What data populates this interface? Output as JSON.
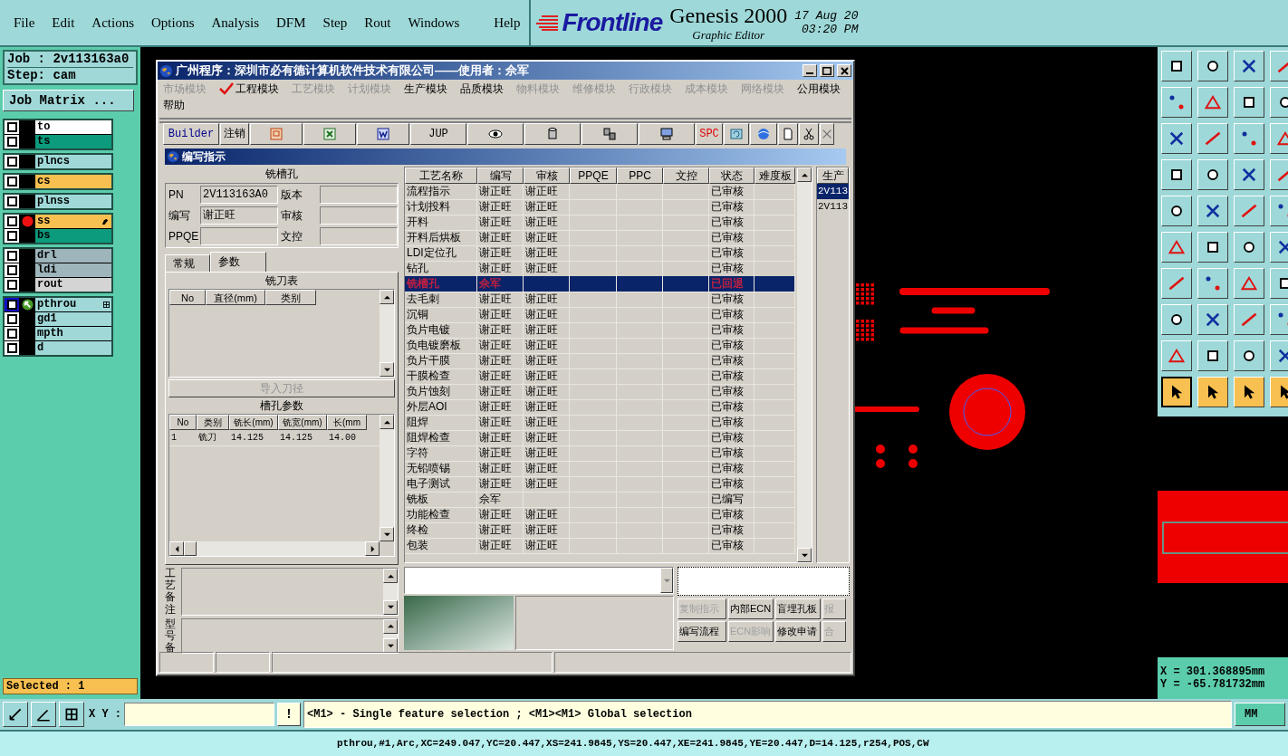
{
  "menu_bar": {
    "items": [
      "File",
      "Edit",
      "Actions",
      "Options",
      "Analysis",
      "DFM",
      "Step",
      "Rout",
      "Windows"
    ],
    "help": "Help"
  },
  "brand": {
    "logo": "Frontline",
    "product": "Genesis 2000",
    "subtitle": "Graphic Editor",
    "date": "17 Aug 20",
    "time": "03:20 PM"
  },
  "job_panel": {
    "job": "Job : 2v113163a0",
    "step": "Step: cam",
    "matrix_button": "Job Matrix ...",
    "selected_count": "Selected : 1",
    "layer_groups": [
      {
        "layers": [
          {
            "name": "to",
            "color": "#ffffff",
            "checked": false,
            "work": false,
            "displayed": false,
            "pointer": false,
            "expandable": false
          },
          {
            "name": "ts",
            "color": "#0c9b7c",
            "checked": false,
            "work": false,
            "displayed": false,
            "pointer": false,
            "expandable": false
          }
        ]
      },
      {
        "layers": [
          {
            "name": "plncs",
            "color": "#a0d8d8",
            "checked": false,
            "work": false,
            "displayed": false,
            "pointer": false,
            "expandable": false
          }
        ]
      },
      {
        "layers": [
          {
            "name": "cs",
            "color": "#f8c050",
            "checked": false,
            "work": false,
            "displayed": false,
            "pointer": false,
            "expandable": false
          }
        ]
      },
      {
        "layers": [
          {
            "name": "plnss",
            "color": "#a0d8d8",
            "checked": false,
            "work": false,
            "displayed": false,
            "pointer": false,
            "expandable": false
          }
        ]
      },
      {
        "layers": [
          {
            "name": "ss",
            "color": "#f8c050",
            "checked": false,
            "work": false,
            "displayed": true,
            "pointer": true,
            "expandable": false
          },
          {
            "name": "bs",
            "color": "#0c9b7c",
            "checked": false,
            "work": false,
            "displayed": false,
            "pointer": false,
            "expandable": false
          }
        ]
      },
      {
        "layers": [
          {
            "name": "drl",
            "color": "#9fb5bc",
            "checked": false,
            "work": false,
            "displayed": false,
            "pointer": false,
            "expandable": false
          },
          {
            "name": "ldi",
            "color": "#9fb5bc",
            "checked": false,
            "work": false,
            "displayed": false,
            "pointer": false,
            "expandable": false
          },
          {
            "name": "rout",
            "color": "#d4d4d4",
            "checked": false,
            "work": false,
            "displayed": false,
            "pointer": false,
            "expandable": false
          }
        ]
      },
      {
        "layers": [
          {
            "name": "pthrou",
            "color": "#a0d8d8",
            "checked": false,
            "work": true,
            "displayed": false,
            "pointer": false,
            "expandable": true
          },
          {
            "name": "gd1",
            "color": "#a0d8d8",
            "checked": false,
            "work": false,
            "displayed": false,
            "pointer": false,
            "expandable": false
          },
          {
            "name": "mpth",
            "color": "#a0d8d8",
            "checked": false,
            "work": false,
            "displayed": false,
            "pointer": false,
            "expandable": false
          },
          {
            "name": "d",
            "color": "#a0d8d8",
            "checked": false,
            "work": false,
            "displayed": false,
            "pointer": false,
            "expandable": false
          }
        ]
      }
    ]
  },
  "dialog": {
    "title": "广州程序：深圳市必有德计算机软件技术有限公司——使用者：佘军",
    "modules": [
      {
        "label": "市场模块",
        "disabled": true,
        "checked": false
      },
      {
        "label": "工程模块",
        "disabled": false,
        "checked": true
      },
      {
        "label": "工艺模块",
        "disabled": true,
        "checked": false
      },
      {
        "label": "计划模块",
        "disabled": true,
        "checked": false
      },
      {
        "label": "生产模块",
        "disabled": false,
        "checked": false
      },
      {
        "label": "品质模块",
        "disabled": false,
        "checked": false
      },
      {
        "label": "物料模块",
        "disabled": true,
        "checked": false
      },
      {
        "label": "维修模块",
        "disabled": true,
        "checked": false
      },
      {
        "label": "行政模块",
        "disabled": true,
        "checked": false
      },
      {
        "label": "成本模块",
        "disabled": true,
        "checked": false
      },
      {
        "label": "网络模块",
        "disabled": true,
        "checked": false
      },
      {
        "label": "公用模块",
        "disabled": false,
        "checked": false
      },
      {
        "label": "帮助",
        "disabled": false,
        "checked": false
      }
    ],
    "toolbar": [
      {
        "kind": "text",
        "label": "Builder",
        "color": "#00008b"
      },
      {
        "kind": "text",
        "label": "注销",
        "color": "#000000"
      },
      {
        "kind": "icon"
      },
      {
        "kind": "icon"
      },
      {
        "kind": "icon"
      },
      {
        "kind": "text",
        "label": "JUP",
        "color": "#000000"
      },
      {
        "kind": "icon"
      },
      {
        "kind": "icon"
      },
      {
        "kind": "icon"
      },
      {
        "kind": "icon"
      },
      {
        "kind": "text",
        "label": "SPC",
        "color": "#e00000"
      },
      {
        "kind": "icon"
      },
      {
        "kind": "icon"
      },
      {
        "kind": "icon"
      },
      {
        "kind": "icon"
      },
      {
        "kind": "icon"
      }
    ],
    "subwindow": {
      "title": "编写指示",
      "process_title": "铣槽孔",
      "fields": [
        {
          "label": "PN",
          "value": "2V113163A0"
        },
        {
          "label": "版本"
        },
        {
          "label": "编写",
          "value": "谢正旺"
        },
        {
          "label": "审核"
        },
        {
          "label": "PPQE"
        },
        {
          "label": "文控"
        }
      ],
      "tabs": [
        {
          "label": "常规",
          "selected": false
        },
        {
          "label": "参数",
          "selected": true
        }
      ],
      "cutter_table": {
        "title": "铣刀表",
        "columns": [
          "No",
          "直径(mm)",
          "类别"
        ]
      },
      "import_button": {
        "label": "导入刀径",
        "disabled": true
      },
      "slot_table": {
        "title": "槽孔参数",
        "columns": [
          "No",
          "类别",
          "铣长(mm)",
          "铣宽(mm)",
          "长(mm"
        ],
        "rows": [
          [
            "1",
            "铣刀",
            "14.125",
            "14.125",
            "14.00"
          ]
        ]
      },
      "notes": [
        "工艺备注",
        "型号备"
      ],
      "process_table": {
        "columns": [
          "工艺名称",
          "编写",
          "审核",
          "PPQE",
          "PPC",
          "文控",
          "状态",
          "难度板"
        ],
        "rows": [
          {
            "name": "流程指示",
            "writer": "谢正旺",
            "reviewer": "谢正旺",
            "status": "已审核",
            "selected": false
          },
          {
            "name": "计划投料",
            "writer": "谢正旺",
            "reviewer": "谢正旺",
            "status": "已审核",
            "selected": false
          },
          {
            "name": "开料",
            "writer": "谢正旺",
            "reviewer": "谢正旺",
            "status": "已审核",
            "selected": false
          },
          {
            "name": "开料后烘板",
            "writer": "谢正旺",
            "reviewer": "谢正旺",
            "status": "已审核",
            "selected": false
          },
          {
            "name": "LDI定位孔",
            "writer": "谢正旺",
            "reviewer": "谢正旺",
            "status": "已审核",
            "selected": false
          },
          {
            "name": "钻孔",
            "writer": "谢正旺",
            "reviewer": "谢正旺",
            "status": "已审核",
            "selected": false
          },
          {
            "name": "铣槽孔",
            "writer": "佘军",
            "status": "已回退",
            "selected": true
          },
          {
            "name": "去毛刺",
            "writer": "谢正旺",
            "reviewer": "谢正旺",
            "status": "已审核",
            "selected": false
          },
          {
            "name": "沉铜",
            "writer": "谢正旺",
            "reviewer": "谢正旺",
            "status": "已审核",
            "selected": false
          },
          {
            "name": "负片电镀",
            "writer": "谢正旺",
            "reviewer": "谢正旺",
            "status": "已审核",
            "selected": false
          },
          {
            "name": "负电镀磨板",
            "writer": "谢正旺",
            "reviewer": "谢正旺",
            "status": "已审核",
            "selected": false
          },
          {
            "name": "负片干膜",
            "writer": "谢正旺",
            "reviewer": "谢正旺",
            "status": "已审核",
            "selected": false
          },
          {
            "name": "干膜检查",
            "writer": "谢正旺",
            "reviewer": "谢正旺",
            "status": "已审核",
            "selected": false
          },
          {
            "name": "负片蚀刻",
            "writer": "谢正旺",
            "reviewer": "谢正旺",
            "status": "已审核",
            "selected": false
          },
          {
            "name": "外层AOI",
            "writer": "谢正旺",
            "reviewer": "谢正旺",
            "status": "已审核",
            "selected": false
          },
          {
            "name": "阻焊",
            "writer": "谢正旺",
            "reviewer": "谢正旺",
            "status": "已审核",
            "selected": false
          },
          {
            "name": "阻焊检查",
            "writer": "谢正旺",
            "reviewer": "谢正旺",
            "status": "已审核",
            "selected": false
          },
          {
            "name": "字符",
            "writer": "谢正旺",
            "reviewer": "谢正旺",
            "status": "已审核",
            "selected": false
          },
          {
            "name": "无铅喷锡",
            "writer": "谢正旺",
            "reviewer": "谢正旺",
            "status": "已审核",
            "selected": false
          },
          {
            "name": "电子测试",
            "writer": "谢正旺",
            "reviewer": "谢正旺",
            "status": "已审核",
            "selected": false
          },
          {
            "name": "铣板",
            "writer": "佘军",
            "status": "已编写",
            "selected": false
          },
          {
            "name": "功能检查",
            "writer": "谢正旺",
            "reviewer": "谢正旺",
            "status": "已审核",
            "selected": false
          },
          {
            "name": "终检",
            "writer": "谢正旺",
            "reviewer": "谢正旺",
            "status": "已审核",
            "selected": false
          },
          {
            "name": "包装",
            "writer": "谢正旺",
            "reviewer": "谢正旺",
            "status": "已审核",
            "selected": false
          }
        ]
      },
      "job_list": {
        "header": "生产",
        "items": [
          {
            "label": "2V113",
            "selected": true
          },
          {
            "label": "2V113",
            "selected": false
          }
        ]
      },
      "action_buttons": [
        {
          "label": "复制指示",
          "disabled": true
        },
        {
          "label": "内部ECN",
          "disabled": false
        },
        {
          "label": "盲埋孔板",
          "disabled": false
        },
        {
          "label": "报",
          "disabled": true
        },
        {
          "label": "编写流程",
          "disabled": false
        },
        {
          "label": "ECN影响",
          "disabled": true
        },
        {
          "label": "修改申请",
          "disabled": false
        },
        {
          "label": "合",
          "disabled": true
        }
      ]
    }
  },
  "tool_groups": [
    {
      "kind": "tools",
      "buttons": [
        {
          "selected": false
        },
        {
          "selected": false
        },
        {
          "selected": false
        },
        {
          "selected": false
        },
        {
          "selected": false
        },
        {
          "selected": false
        },
        {
          "selected": false
        },
        {
          "selected": false
        },
        {
          "selected": false
        },
        {
          "selected": false
        },
        {
          "selected": false
        },
        {
          "selected": false
        },
        {
          "selected": false
        },
        {
          "selected": false
        },
        {
          "selected": false
        },
        {
          "selected": false
        }
      ]
    },
    {
      "kind": "tools",
      "buttons": [
        {
          "selected": false
        },
        {
          "selected": false
        },
        {
          "selected": false
        },
        {
          "selected": false
        },
        {
          "selected": false
        },
        {
          "selected": false
        },
        {
          "selected": false
        },
        {
          "selected": false
        },
        {
          "selected": false
        },
        {
          "selected": false
        },
        {
          "selected": false
        },
        {
          "selected": false
        },
        {
          "selected": false
        },
        {
          "selected": false
        },
        {
          "selected": false
        },
        {
          "selected": false
        },
        {
          "selected": false
        },
        {
          "selected": false
        },
        {
          "selected": false
        },
        {
          "selected": false
        }
      ]
    },
    {
      "kind": "modes",
      "buttons": [
        {
          "selected": true
        },
        {
          "selected": false
        },
        {
          "selected": false
        },
        {
          "selected": false
        }
      ]
    }
  ],
  "coordinates": {
    "x": "X = 301.368895mm",
    "y": "Y = -65.781732mm"
  },
  "command_bar": {
    "xy_label": "X Y :",
    "alert_button": "!",
    "message": "<M1> - Single feature selection ; <M1><M1> Global selection",
    "units": "MM"
  },
  "status_line": "pthrou,#1,Arc,XC=249.047,YC=20.447,XS=241.9845,YS=20.447,XE=241.9845,YE=20.447,D=14.125,r254,POS,CW"
}
